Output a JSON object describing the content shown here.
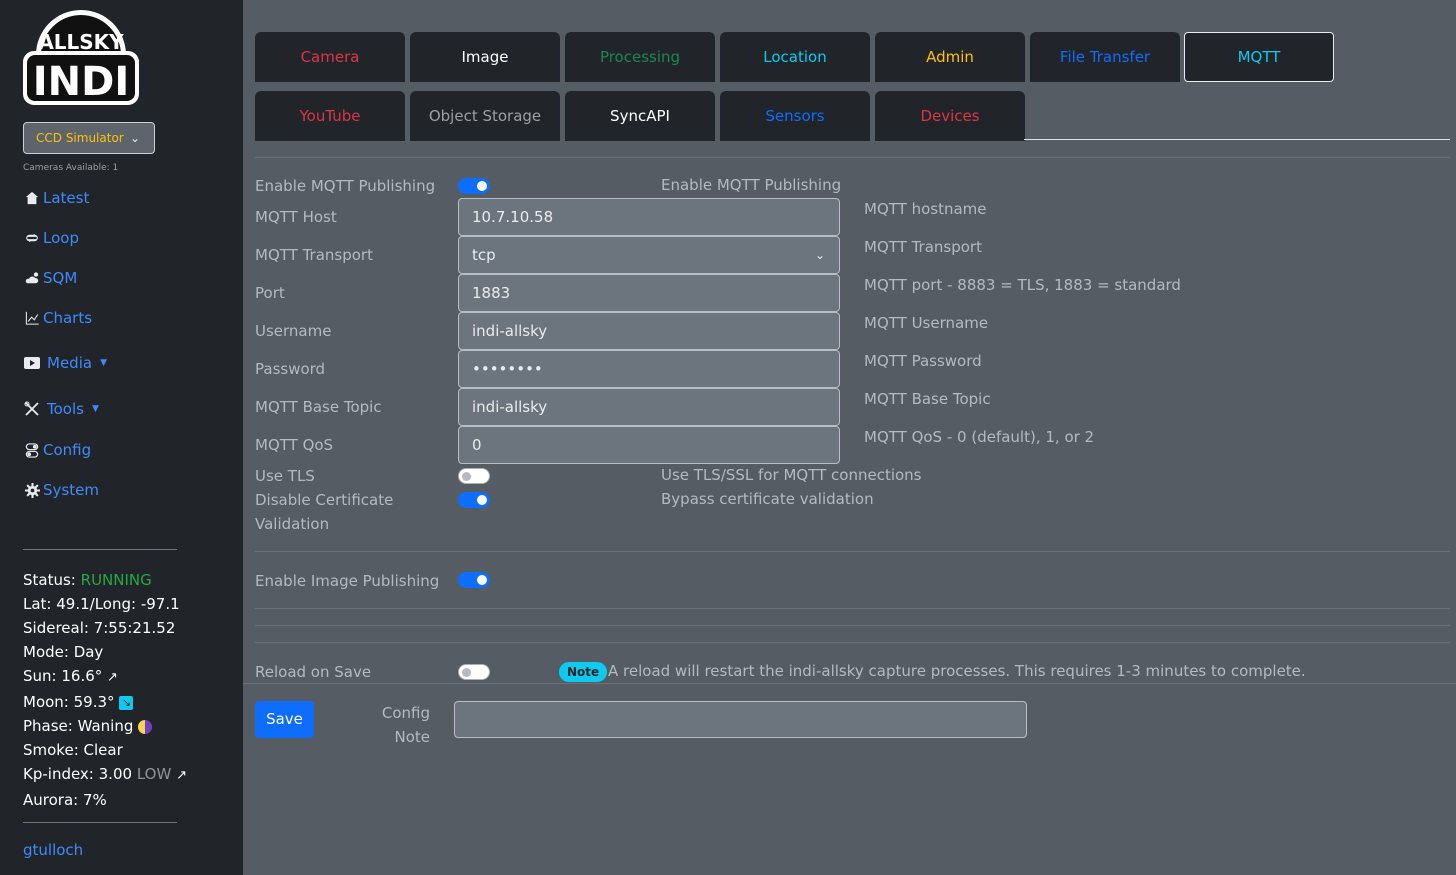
{
  "logo": {
    "text_top": "ALLSKY",
    "text_main": "INDI"
  },
  "camera_select": {
    "value": "CCD Simulator",
    "available": "Cameras Available: 1"
  },
  "nav": [
    {
      "label": "Latest",
      "icon": "house-icon"
    },
    {
      "label": "Loop",
      "icon": "loop-icon"
    },
    {
      "label": "SQM",
      "icon": "cloud-moon-icon"
    },
    {
      "label": "Charts",
      "icon": "chart-icon"
    },
    {
      "label": "Media",
      "icon": "play-icon"
    },
    {
      "label": "Tools",
      "icon": "tools-icon"
    },
    {
      "label": "Config",
      "icon": "toggles-icon"
    },
    {
      "label": "System",
      "icon": "gear-icon"
    }
  ],
  "status": {
    "status_label": "Status:",
    "status_value": "RUNNING",
    "latlong": "Lat: 49.1/Long: -97.1",
    "sidereal": "Sidereal: 7:55:21.52",
    "mode": "Mode: Day",
    "sun": "Sun: 16.6°",
    "moon": "Moon: 59.3°",
    "phase": "Phase: Waning",
    "smoke": "Smoke: Clear",
    "kp": "Kp-index: 3.00",
    "kp_level": "LOW",
    "aurora": "Aurora: 7%"
  },
  "user": "gtulloch",
  "tabs_row1": [
    {
      "label": "Camera",
      "color": "#dc3545"
    },
    {
      "label": "Image",
      "color": "#ffffff"
    },
    {
      "label": "Processing",
      "color": "#198754"
    },
    {
      "label": "Location",
      "color": "#0dcaf0"
    },
    {
      "label": "Admin",
      "color": "#ffc107"
    },
    {
      "label": "File Transfer",
      "color": "#0d6efd"
    },
    {
      "label": "MQTT",
      "color": "#0dcaf0"
    }
  ],
  "tabs_row2": [
    {
      "label": "YouTube",
      "color": "#dc3545"
    },
    {
      "label": "Object Storage",
      "color": "#9aa0a6"
    },
    {
      "label": "SyncAPI",
      "color": "#ffffff"
    },
    {
      "label": "Sensors",
      "color": "#0d6efd"
    },
    {
      "label": "Devices",
      "color": "#dc3545"
    }
  ],
  "form": {
    "enable_label": "Enable MQTT Publishing",
    "enable_help": "Enable MQTT Publishing",
    "host_label": "MQTT Host",
    "host_value": "10.7.10.58",
    "host_help": "MQTT hostname",
    "transport_label": "MQTT Transport",
    "transport_value": "tcp",
    "transport_help": "MQTT Transport",
    "port_label": "Port",
    "port_value": "1883",
    "port_help": "MQTT port - 8883 = TLS, 1883 = standard",
    "username_label": "Username",
    "username_value": "indi-allsky",
    "username_help": "MQTT Username",
    "password_label": "Password",
    "password_value": "••••••••",
    "password_help": "MQTT Password",
    "topic_label": "MQTT Base Topic",
    "topic_value": "indi-allsky",
    "topic_help": "MQTT Base Topic",
    "qos_label": "MQTT QoS",
    "qos_value": "0",
    "qos_help": "MQTT QoS - 0 (default), 1, or 2",
    "tls_label": "Use TLS",
    "tls_help": "Use TLS/SSL for MQTT connections",
    "cert_label_1": "Disable Certificate",
    "cert_label_2": "Validation",
    "cert_help": "Bypass certificate validation",
    "image_label": "Enable Image Publishing",
    "reload_label": "Reload on Save",
    "note_badge": "Note",
    "reload_note": "A reload will restart the indi-allsky capture processes. This requires 1-3 minutes to complete.",
    "save": "Save",
    "config_note_1": "Config",
    "config_note_2": "Note"
  }
}
